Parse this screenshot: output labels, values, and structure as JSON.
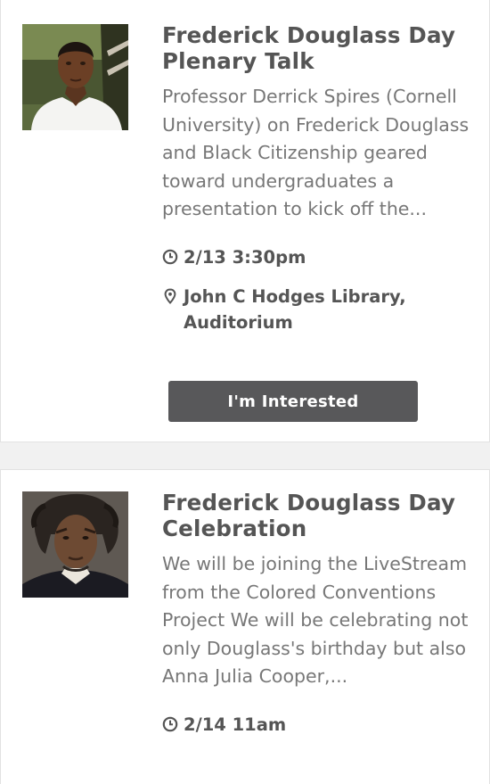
{
  "events": [
    {
      "title": "Frederick Douglass Day Plenary Talk",
      "description": "Professor Derrick Spires (Cornell University) on Frederick Douglass and Black Citizenship geared toward undergraduates a presentation to kick off the...",
      "time": "2/13 3:30pm",
      "location": "John C Hodges Library, Auditorium",
      "button_label": "I'm Interested",
      "icons": {
        "time": "clock-icon",
        "location": "map-pin-icon"
      }
    },
    {
      "title": "Frederick Douglass Day Celebration",
      "description": "We will be joining the LiveStream from the Colored Conventions Project We will be celebrating not only Douglass's birthday but also Anna Julia Cooper,...",
      "time": "2/14 11am",
      "icons": {
        "time": "clock-icon"
      }
    }
  ],
  "colors": {
    "title": "#555555",
    "description": "#777777",
    "button_bg": "#58585a",
    "button_text": "#ffffff",
    "page_bg": "#f1f1f1",
    "card_bg": "#ffffff"
  }
}
